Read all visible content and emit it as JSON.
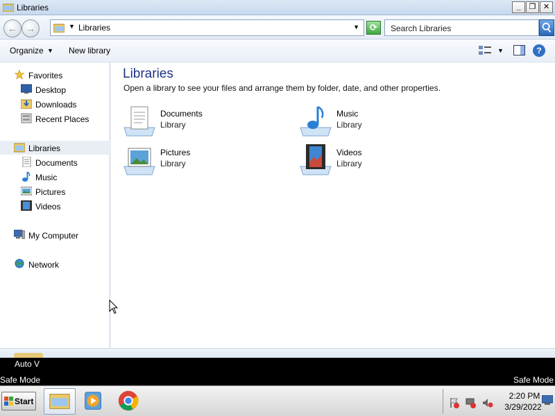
{
  "window": {
    "title": "Libraries",
    "minimize_label": "_",
    "maximize_label": "❐",
    "close_label": "✕"
  },
  "addressbar": {
    "back_label": "←",
    "forward_label": "→",
    "path": "Libraries",
    "search_placeholder": "Search Libraries"
  },
  "commandbar": {
    "organize": "Organize",
    "new_library": "New library",
    "help": "?"
  },
  "navpane": {
    "favorites": {
      "label": "Favorites",
      "icon": "star-icon"
    },
    "favorite_items": [
      {
        "label": "Desktop",
        "icon": "desktop-icon"
      },
      {
        "label": "Downloads",
        "icon": "downloads-icon"
      },
      {
        "label": "Recent Places",
        "icon": "recent-places-icon"
      }
    ],
    "libraries": {
      "label": "Libraries",
      "icon": "libraries-icon"
    },
    "library_items": [
      {
        "label": "Documents",
        "icon": "documents-icon"
      },
      {
        "label": "Music",
        "icon": "music-icon"
      },
      {
        "label": "Pictures",
        "icon": "pictures-icon"
      },
      {
        "label": "Videos",
        "icon": "videos-icon"
      }
    ],
    "computer": {
      "label": "My Computer",
      "icon": "computer-icon"
    },
    "network": {
      "label": "Network",
      "icon": "network-icon"
    }
  },
  "main": {
    "heading": "Libraries",
    "description": "Open a library to see your files and arrange them by folder, date, and other properties.",
    "libraries": [
      {
        "name": "Documents",
        "type": "Library",
        "icon": "documents-library-icon"
      },
      {
        "name": "Music",
        "type": "Library",
        "icon": "music-library-icon"
      },
      {
        "name": "Pictures",
        "type": "Library",
        "icon": "pictures-library-icon"
      },
      {
        "name": "Videos",
        "type": "Library",
        "icon": "videos-library-icon"
      }
    ]
  },
  "overlay": {
    "auto_v": "Auto V",
    "safe_mode_left": "Safe Mode",
    "safe_mode_right": "Safe Mode"
  },
  "taskbar": {
    "start_label": "Start",
    "time": "2:20 PM",
    "date": "3/29/2022"
  },
  "colors": {
    "accent": "#1e3287",
    "selection": "#e9eef5"
  }
}
